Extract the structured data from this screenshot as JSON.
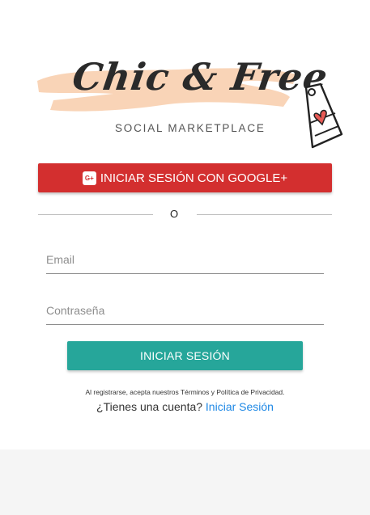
{
  "brand": {
    "name": "Chic & Free",
    "tagline": "SOCIAL MARKETPLACE",
    "brush_color": "#f9d2b3",
    "icon": "price-tag-heart-icon"
  },
  "google": {
    "label": "INICIAR SESIÓN CON GOOGLE+",
    "icon_text": "G+",
    "color": "#d32f2f"
  },
  "divider": {
    "text": "O"
  },
  "form": {
    "email_placeholder": "Email",
    "password_placeholder": "Contraseña"
  },
  "login": {
    "label": "INICIAR SESIÓN",
    "color": "#26a69a"
  },
  "footer": {
    "terms": "Al registrarse, acepta nuestros Términos y Política de Privacidad.",
    "question": "¿Tienes una cuenta?",
    "login_link": "Iniciar Sesión",
    "link_color": "#1e88e5"
  }
}
